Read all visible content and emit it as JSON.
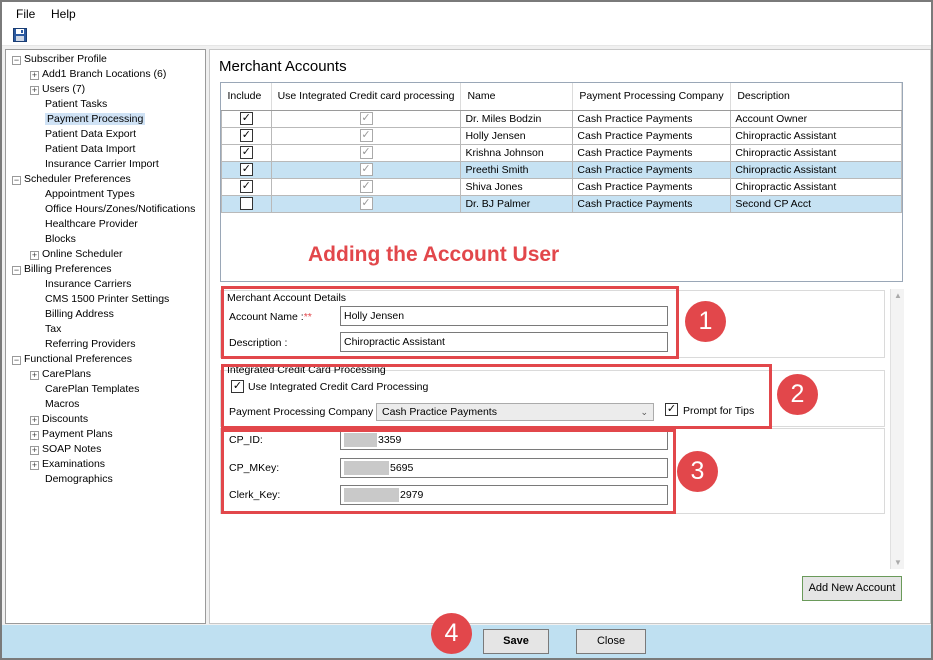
{
  "menu": [
    "File",
    "Help"
  ],
  "tree": [
    {
      "label": "Subscriber Profile",
      "level": 0,
      "expander": "-"
    },
    {
      "label": "Add1 Branch Locations (6)",
      "level": 1,
      "expander": "+"
    },
    {
      "label": "Users (7)",
      "level": 1,
      "expander": "+"
    },
    {
      "label": "Patient Tasks",
      "level": 1,
      "expander": ""
    },
    {
      "label": "Payment Processing",
      "level": 1,
      "expander": "",
      "selected": true
    },
    {
      "label": "Patient Data Export",
      "level": 1,
      "expander": ""
    },
    {
      "label": "Patient Data Import",
      "level": 1,
      "expander": ""
    },
    {
      "label": "Insurance Carrier Import",
      "level": 1,
      "expander": ""
    },
    {
      "label": "Scheduler Preferences",
      "level": 0,
      "expander": "-"
    },
    {
      "label": "Appointment Types",
      "level": 1,
      "expander": ""
    },
    {
      "label": "Office Hours/Zones/Notifications",
      "level": 1,
      "expander": ""
    },
    {
      "label": "Healthcare Provider",
      "level": 1,
      "expander": ""
    },
    {
      "label": "Blocks",
      "level": 1,
      "expander": ""
    },
    {
      "label": "Online Scheduler",
      "level": 1,
      "expander": "+"
    },
    {
      "label": "Billing Preferences",
      "level": 0,
      "expander": "-"
    },
    {
      "label": "Insurance Carriers",
      "level": 1,
      "expander": ""
    },
    {
      "label": "CMS 1500 Printer Settings",
      "level": 1,
      "expander": ""
    },
    {
      "label": "Billing Address",
      "level": 1,
      "expander": ""
    },
    {
      "label": "Tax",
      "level": 1,
      "expander": ""
    },
    {
      "label": "Referring Providers",
      "level": 1,
      "expander": ""
    },
    {
      "label": "Functional Preferences",
      "level": 0,
      "expander": "-"
    },
    {
      "label": "CarePlans",
      "level": 1,
      "expander": "+"
    },
    {
      "label": "CarePlan Templates",
      "level": 1,
      "expander": ""
    },
    {
      "label": "Macros",
      "level": 1,
      "expander": ""
    },
    {
      "label": "Discounts",
      "level": 1,
      "expander": "+"
    },
    {
      "label": "Payment Plans",
      "level": 1,
      "expander": "+"
    },
    {
      "label": "SOAP Notes",
      "level": 1,
      "expander": "+"
    },
    {
      "label": "Examinations",
      "level": 1,
      "expander": "+"
    },
    {
      "label": "Demographics",
      "level": 1,
      "expander": ""
    }
  ],
  "page_title": "Merchant Accounts",
  "grid": {
    "columns": [
      "Include",
      "Use Integrated Credit card processing",
      "Name",
      "Payment Processing Company",
      "Description"
    ],
    "rows": [
      {
        "include": true,
        "integrated": true,
        "name": "Dr. Miles Bodzin",
        "company": "Cash Practice Payments",
        "description": "Account Owner",
        "highlight": false
      },
      {
        "include": true,
        "integrated": true,
        "name": "Holly Jensen",
        "company": "Cash Practice Payments",
        "description": "Chiropractic Assistant",
        "highlight": false
      },
      {
        "include": true,
        "integrated": true,
        "name": "Krishna Johnson",
        "company": "Cash Practice Payments",
        "description": "Chiropractic Assistant",
        "highlight": false
      },
      {
        "include": true,
        "integrated": true,
        "name": "Preethi Smith",
        "company": "Cash Practice Payments",
        "description": "Chiropractic Assistant",
        "highlight": true
      },
      {
        "include": true,
        "integrated": true,
        "name": "Shiva Jones",
        "company": "Cash Practice Payments",
        "description": "Chiropractic Assistant",
        "highlight": false
      },
      {
        "include": false,
        "integrated": true,
        "name": "Dr. BJ Palmer",
        "company": "Cash Practice Payments",
        "description": "Second CP Acct",
        "highlight": true
      }
    ]
  },
  "annotation_title": "Adding the Account User",
  "details": {
    "group_label": "Merchant Account Details",
    "account_name_label": "Account Name :",
    "required_mark": "**",
    "account_name_value": "Holly Jensen",
    "description_label": "Description :",
    "description_value": "Chiropractic Assistant"
  },
  "integrated": {
    "group_label": "Integrated Credit Card Processing",
    "use_label": "Use Integrated Credit Card Processing",
    "use_checked": true,
    "company_label": "Payment Processing Company",
    "company_value": "Cash Practice Payments",
    "tips_label": "Prompt for Tips",
    "tips_checked": true
  },
  "keys": {
    "cp_id_label": "CP_ID:",
    "cp_id_value": "3359",
    "cp_mkey_label": "CP_MKey:",
    "cp_mkey_value": "5695",
    "clerk_key_label": "Clerk_Key:",
    "clerk_key_value": "2979"
  },
  "badges": [
    "1",
    "2",
    "3",
    "4"
  ],
  "buttons": {
    "add_new_account": "Add New Account",
    "save": "Save",
    "close": "Close"
  },
  "icons": {
    "save_tool": "floppy-disk-icon",
    "check": "checkmark-icon",
    "dropdown": "chevron-down-icon"
  },
  "colors": {
    "annotation_red": "#e2474b",
    "row_highlight": "#c6e2f3",
    "bottom_bar": "#bfe0f1"
  }
}
